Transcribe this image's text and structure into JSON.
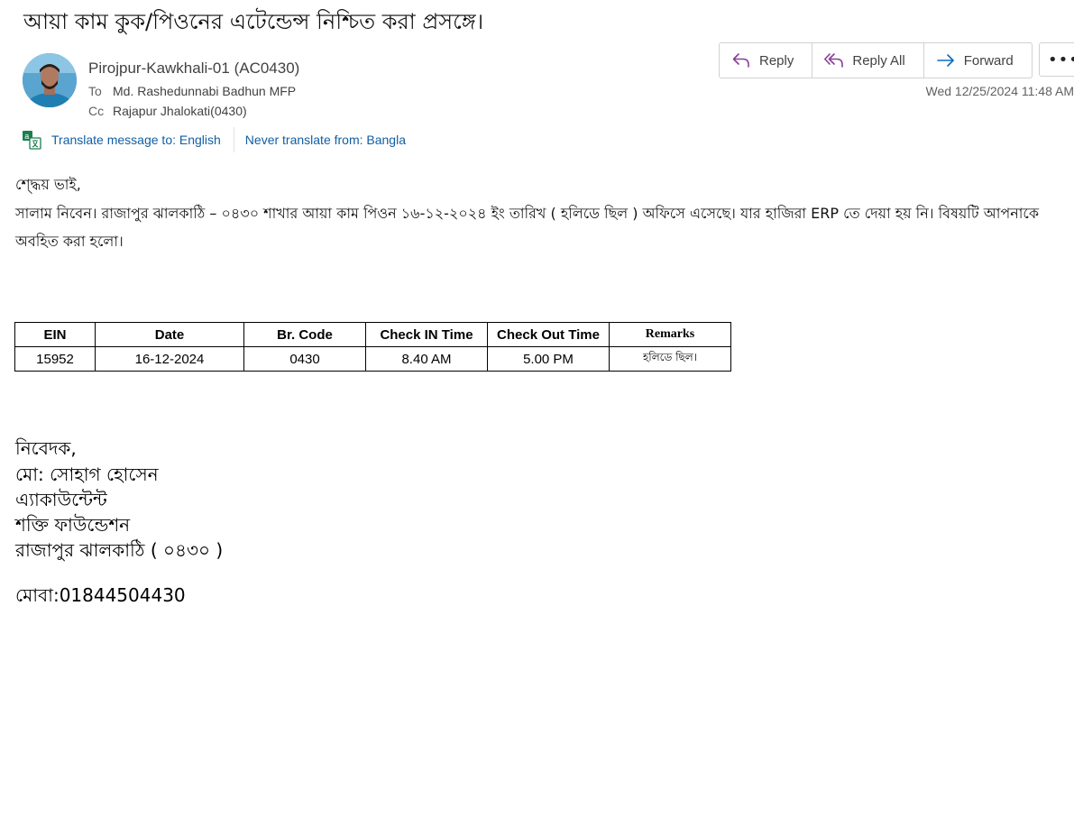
{
  "email": {
    "subject": "আয়া কাম কুক/পিওনের এটেন্ডেন্স নিশ্চিত করা প্রসঙ্গে।",
    "sender": "Pirojpur-Kawkhali-01 (AC0430)",
    "to_label": "To",
    "to": "Md. Rashedunnabi Badhun MFP",
    "cc_label": "Cc",
    "cc": "Rajapur Jhalokati(0430)",
    "date": "Wed 12/25/2024 11:48 AM"
  },
  "actions": {
    "reply": "Reply",
    "reply_all": "Reply All",
    "forward": "Forward",
    "more": "•••"
  },
  "translate": {
    "translate_to": "Translate message to: English",
    "never_translate": "Never translate from: Bangla"
  },
  "body": {
    "greeting": "শ্দ্ধেয় ভাই,",
    "line1": "সালাম নিবেন। রাজাপুর ঝালকাঠি – ০৪৩০ শাখার আয়া কাম পিওন ১৬-১২-২০২৪ ইং তারিখ ( হলিডে ছিল ) অফিসে এসেছে। যার হাজিরা ERP তে দেয়া হয় নি। বিষয়টি আপনাকে",
    "line2": "অবহিত করা হলো।"
  },
  "table": {
    "headers": [
      "EIN",
      "Date",
      "Br. Code",
      "Check IN Time",
      "Check Out Time",
      "Remarks"
    ],
    "rows": [
      [
        "15952",
        "16-12-2024",
        "0430",
        "8.40 AM",
        "5.00 PM",
        "হলিডে ছিল।"
      ]
    ]
  },
  "signature": {
    "l1": "নিবেদক,",
    "l2": "মো: সোহাগ হোসেন",
    "l3": "এ্যাকাউন্টেন্ট",
    "l4": "শক্তি ফাউন্ডেশন",
    "l5": "রাজাপুর ঝালকাঠি   ( ০৪৩০ )",
    "phone": "মোবা:01844504430"
  },
  "colors": {
    "link": "#115ea3",
    "reply_icon": "#8a3d9b",
    "forward_icon": "#0f6cbd"
  }
}
